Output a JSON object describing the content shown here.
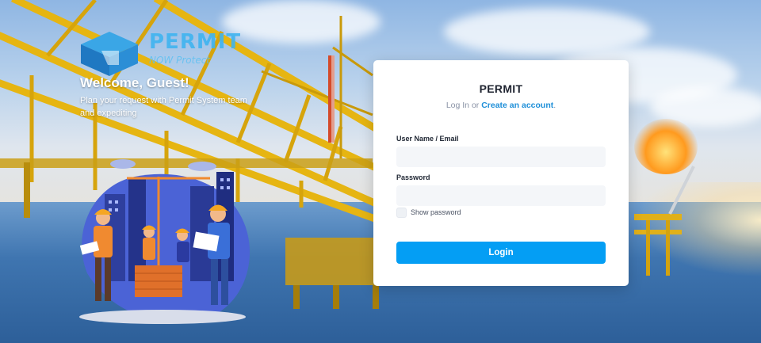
{
  "brand": {
    "logo_word": "PERMIT",
    "logo_sub": "NOW Protect"
  },
  "hero": {
    "welcome": "Welcome, Guest!",
    "tagline": "Plan your request with Permit System team and expediting"
  },
  "login_card": {
    "title": "PERMIT",
    "subtitle_prefix": "Log In or ",
    "create_account_link": "Create an account",
    "subtitle_suffix": ".",
    "username_label": "User Name / Email",
    "username_value": "",
    "password_label": "Password",
    "password_value": "",
    "show_password_label": "Show password",
    "show_password_checked": false,
    "login_button": "Login"
  },
  "colors": {
    "accent": "#049ef4",
    "link": "#1e8fd8",
    "card_bg": "#ffffff",
    "input_bg": "#f4f6f9"
  },
  "icons": {
    "logo": "permit-logo-cube-icon",
    "illustration": "construction-workers-illustration"
  }
}
